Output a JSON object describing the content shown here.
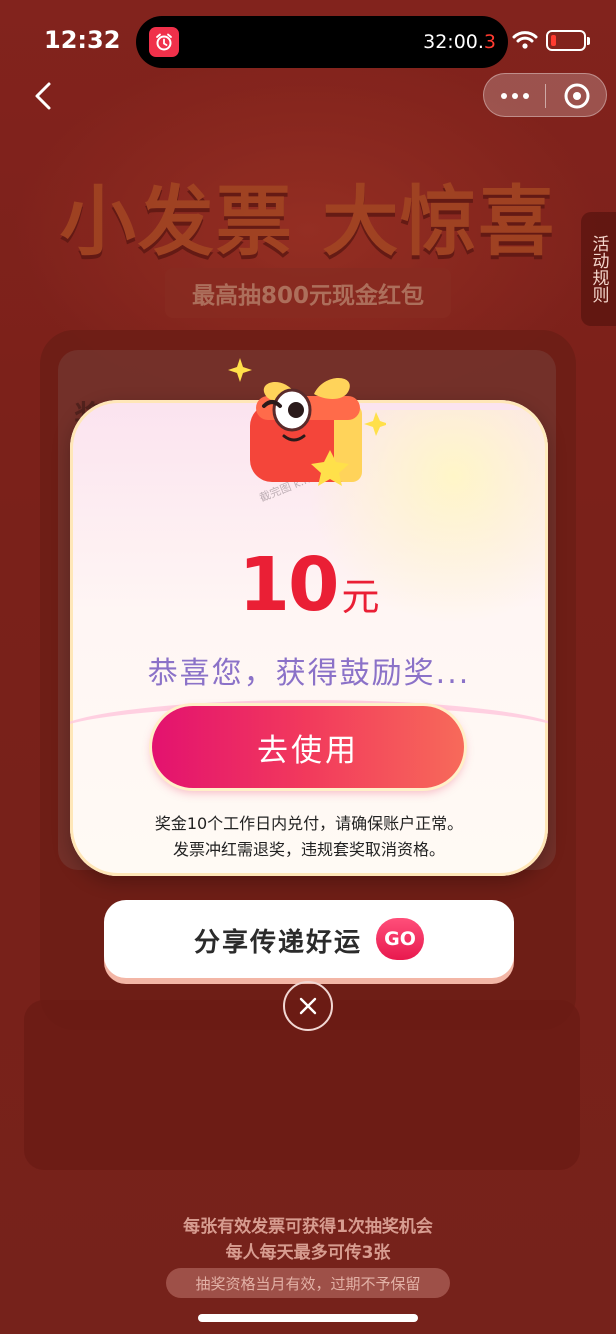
{
  "status_bar": {
    "time": "12:32",
    "timer_main": "32:00.",
    "timer_decimal": "3",
    "app_icon": "alarm-clock-icon",
    "wifi_icon": "wifi-icon",
    "battery_icon": "battery-low-icon",
    "battery_level_fraction": 0.15
  },
  "nav": {
    "back_icon": "chevron-left-icon",
    "more_icon": "more-dots-icon",
    "close_icon": "circle-close-icon"
  },
  "background": {
    "title": "小发票 大惊喜",
    "subtitle": "最高抽800元现金红包",
    "rules_tab": "活动规则",
    "panel_label": "奖品"
  },
  "popup": {
    "amount": "10",
    "unit": "元",
    "congrats": "恭喜您，获得鼓励奖...",
    "use_button": "去使用",
    "note_line1": "奖金10个工作日内兑付，请确保账户正常。",
    "note_line2": "发票冲红需退奖，违规套奖取消资格。",
    "watermark": "截完图 k.mainb.com",
    "mascot_icon": "gift-box-mascot-icon"
  },
  "share": {
    "label": "分享传递好运",
    "go": "GO"
  },
  "close_icon": "close-x-icon",
  "footer": {
    "line1": "每张有效发票可获得1次抽奖机会",
    "line2": "每人每天最多可传3张",
    "pill": "抽奖资格当月有效，过期不予保留"
  },
  "colors": {
    "accent_red": "#ea1f35",
    "button_pink": "#e3126f",
    "congrats_purple": "#8b72c8",
    "background_red": "#8e2a22"
  }
}
